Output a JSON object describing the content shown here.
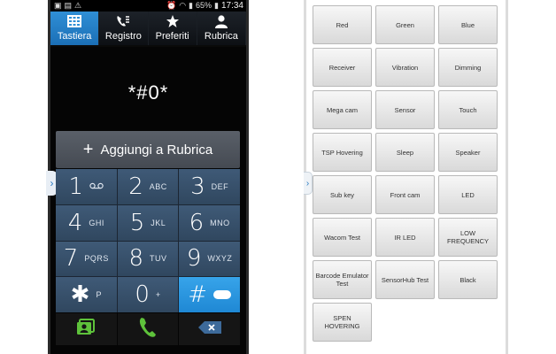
{
  "dialer": {
    "status": {
      "percent": "65%",
      "time": "17:34"
    },
    "tabs": [
      {
        "label": "Tastiera",
        "icon": "keypad-icon",
        "active": true
      },
      {
        "label": "Registro",
        "icon": "call-log-icon",
        "active": false
      },
      {
        "label": "Preferiti",
        "icon": "star-icon",
        "active": false
      },
      {
        "label": "Rubrica",
        "icon": "contact-icon",
        "active": false
      }
    ],
    "number": "*#0*",
    "add_contact_label": "Aggiungi a Rubrica",
    "add_contact_glyph": "+",
    "keys": [
      {
        "digit": "1",
        "letters": "∞"
      },
      {
        "digit": "2",
        "letters": "ABC"
      },
      {
        "digit": "3",
        "letters": "DEF"
      },
      {
        "digit": "4",
        "letters": "GHI"
      },
      {
        "digit": "5",
        "letters": "JKL"
      },
      {
        "digit": "6",
        "letters": "MNO"
      },
      {
        "digit": "7",
        "letters": "PQRS"
      },
      {
        "digit": "8",
        "letters": "TUV"
      },
      {
        "digit": "9",
        "letters": "WXYZ"
      },
      {
        "digit": "✱",
        "letters": "P"
      },
      {
        "digit": "0",
        "letters": "+"
      },
      {
        "digit": "#",
        "letters": ""
      }
    ],
    "colors": {
      "accent": "#2f8fd6",
      "key": "#3f5a77",
      "call_green": "#5ec23b"
    }
  },
  "test_menu": {
    "buttons": [
      "Red",
      "Green",
      "Blue",
      "Receiver",
      "Vibration",
      "Dimming",
      "Mega cam",
      "Sensor",
      "Touch",
      "TSP Hovering",
      "Sleep",
      "Speaker",
      "Sub key",
      "Front cam",
      "LED",
      "Wacom Test",
      "IR LED",
      "LOW FREQUENCY",
      "Barcode Emulator Test",
      "SensorHub Test",
      "Black",
      "SPEN HOVERING"
    ]
  }
}
